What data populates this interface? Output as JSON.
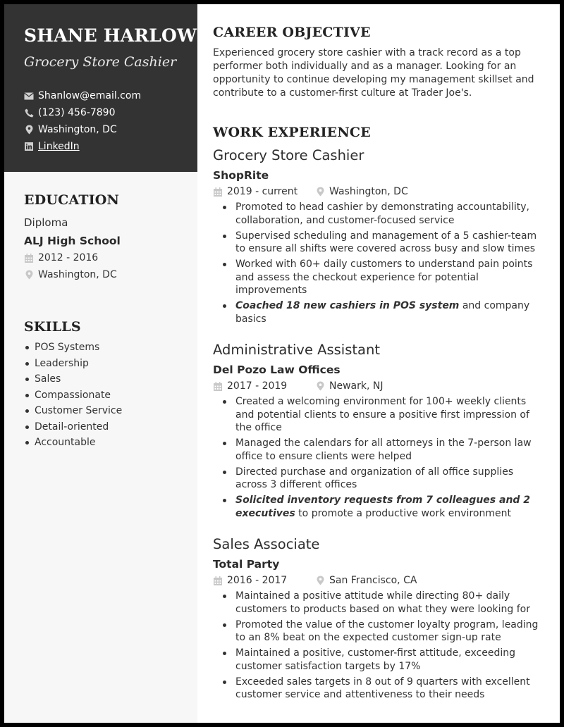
{
  "header": {
    "name": "SHANE HARLOW",
    "title": "Grocery Store Cashier",
    "contacts": {
      "email": "Shanlow@email.com",
      "phone": "(123) 456-7890",
      "location": "Washington, DC",
      "linkedin": "LinkedIn"
    },
    "icons": [
      "envelope-icon",
      "phone-icon",
      "map-pin-icon",
      "linkedin-icon"
    ]
  },
  "education": {
    "heading": "EDUCATION",
    "degree": "Diploma",
    "school": "ALJ High School",
    "dates": "2012 - 2016",
    "location": "Washington, DC"
  },
  "skills": {
    "heading": "SKILLS",
    "items": [
      "POS Systems",
      "Leadership",
      "Sales",
      "Compassionate",
      "Customer Service",
      "Detail-oriented",
      "Accountable"
    ]
  },
  "objective": {
    "heading": "CAREER OBJECTIVE",
    "text": "Experienced grocery store cashier with a track record as a top performer both individually and as a manager. Looking for an opportunity to continue developing my management skillset and contribute to a customer-first culture at Trader Joe's."
  },
  "work": {
    "heading": "WORK EXPERIENCE",
    "jobs": [
      {
        "title": "Grocery Store Cashier",
        "company": "ShopRite",
        "dates": "2019 - current",
        "location": "Washington, DC",
        "bullets": [
          {
            "em": "",
            "text": "Promoted to head cashier by demonstrating accountability, collaboration, and customer-focused service"
          },
          {
            "em": "",
            "text": "Supervised scheduling and management of a 5 cashier-team to ensure all shifts were covered across busy and slow times"
          },
          {
            "em": "",
            "text": "Worked with 60+ daily customers to understand pain points and assess the checkout experience for potential improvements"
          },
          {
            "em": "Coached 18 new cashiers in POS system",
            "text": " and company basics"
          }
        ]
      },
      {
        "title": "Administrative Assistant",
        "company": "Del Pozo Law Offices",
        "dates": "2017 - 2019",
        "location": "Newark, NJ",
        "bullets": [
          {
            "em": "",
            "text": "Created a welcoming environment for 100+ weekly clients and potential clients to ensure a positive first impression of the office"
          },
          {
            "em": "",
            "text": "Managed the calendars for all attorneys in the 7-person law office to ensure clients were helped"
          },
          {
            "em": "",
            "text": "Directed purchase and organization of all office supplies across 3 different offices"
          },
          {
            "em": "Solicited inventory requests from 7 colleagues and 2 executives",
            "text": " to promote a productive work environment"
          }
        ]
      },
      {
        "title": "Sales Associate",
        "company": "Total Party",
        "dates": "2016 - 2017",
        "location": "San Francisco, CA",
        "bullets": [
          {
            "em": "",
            "text": "Maintained a positive attitude while directing 80+ daily customers to products based on what they were looking for"
          },
          {
            "em": "",
            "text": "Promoted the value of the customer loyalty program, leading to an 8% beat on the expected customer sign-up rate"
          },
          {
            "em": "",
            "text": "Maintained a positive, customer-first attitude, exceeding customer satisfaction targets by 17%"
          },
          {
            "em": "",
            "text": "Exceeded sales targets in 8 out of 9 quarters with excellent customer service and attentiveness to their needs"
          }
        ]
      }
    ]
  },
  "colors": {
    "header_bg": "#333333",
    "sidebar_bg": "#f7f7f7",
    "icon_gray": "#c4c4c4",
    "text": "#333333"
  }
}
